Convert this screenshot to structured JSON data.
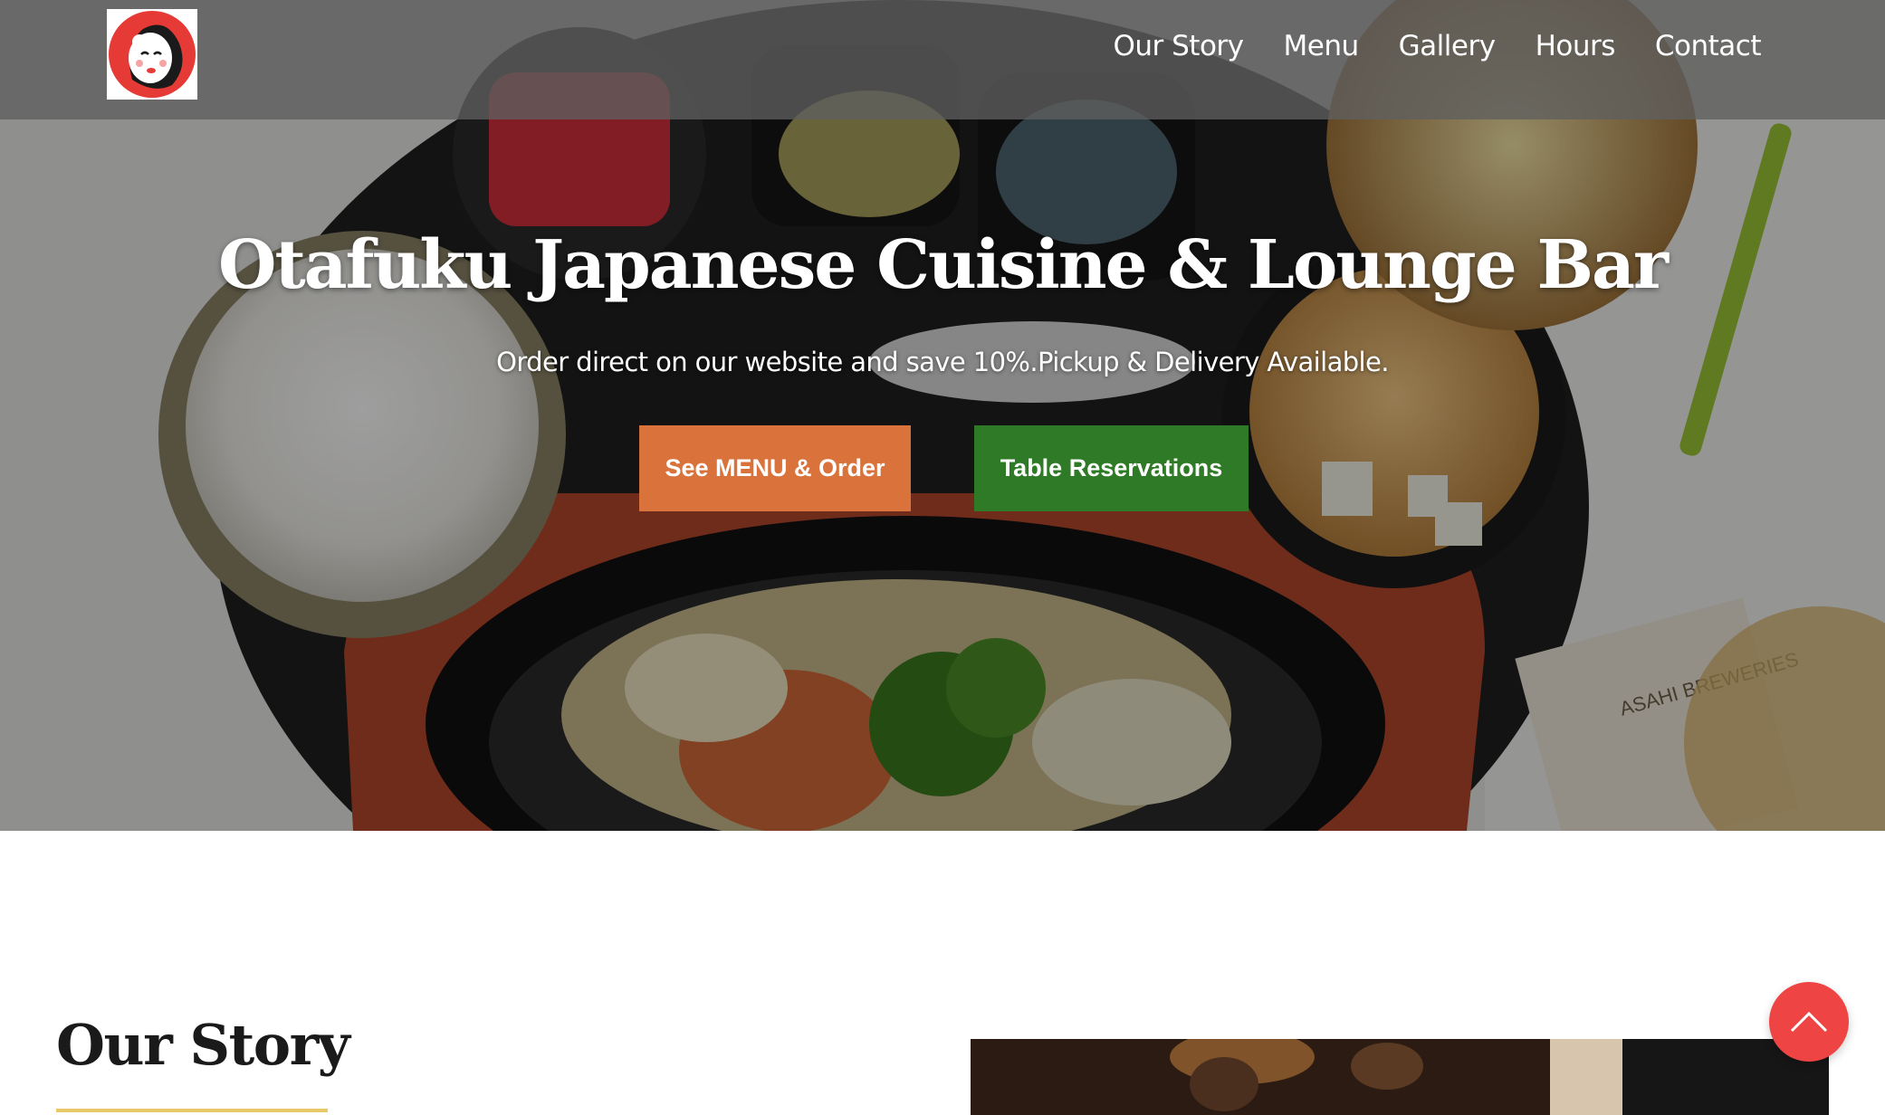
{
  "nav": {
    "logo_alt": "Otafuku logo",
    "links": [
      "Our Story",
      "Menu",
      "Gallery",
      "Hours",
      "Contact"
    ]
  },
  "hero": {
    "title": "Otafuku Japanese Cuisine & Lounge Bar",
    "subtitle": "Order direct on our website and save 10%.Pickup & Delivery Available.",
    "menu_button": "See MENU & Order",
    "reserve_button": "Table Reservations",
    "coaster_text": "ASAHI BREWERIES"
  },
  "story": {
    "heading": "Our Story"
  },
  "colors": {
    "accent_orange": "#d9733b",
    "accent_green": "#2f7a26",
    "underline_gold": "#e8c968",
    "scroll_red": "#ef4444"
  },
  "icons": {
    "scroll_top": "chevron-up-icon"
  }
}
